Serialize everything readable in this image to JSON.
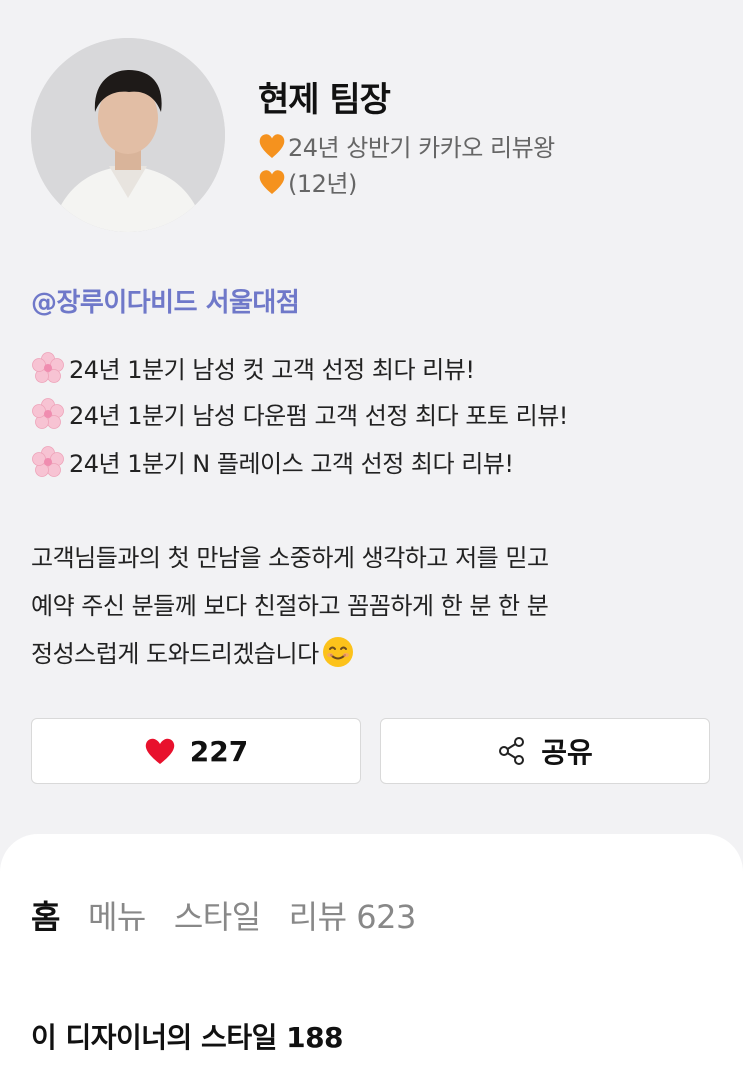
{
  "profile": {
    "name": "현제 팀장",
    "badge_line_1": "24년 상반기 카카오  리뷰왕",
    "badge_line_2": "(12년)",
    "shop": "@장루이다비드 서울대점"
  },
  "intro": [
    " 24년 1분기 남성 컷 고객 선정 최다 리뷰!",
    "24년 1분기  남성 다운펌 고객 선정 최다 포토 리뷰!",
    " 24년 1분기  N 플레이스  고객 선정 최다 리뷰!"
  ],
  "description": [
    "고객님들과의 첫 만남을 소중하게 생각하고 저를 믿고",
    "예약 주신 분들께 보다 친절하고 꼼꼼하게 한 분 한 분",
    "정성스럽게 도와드리겠습니다"
  ],
  "actions": {
    "like_count": "227",
    "share_label": "공유"
  },
  "tabs": [
    "홈",
    "메뉴",
    "스타일",
    "리뷰 623"
  ],
  "section": {
    "title": "이 디자이너의 스타일 188"
  },
  "colors": {
    "accent_tab": "#ffe100",
    "shop_link": "#6f78c9",
    "heart": "#e8112d",
    "orange_heart": "#f5921e"
  },
  "icons": [
    "orange-heart-icon",
    "cherry-blossom-icon",
    "smiling-face-icon",
    "heart-icon",
    "share-icon"
  ]
}
